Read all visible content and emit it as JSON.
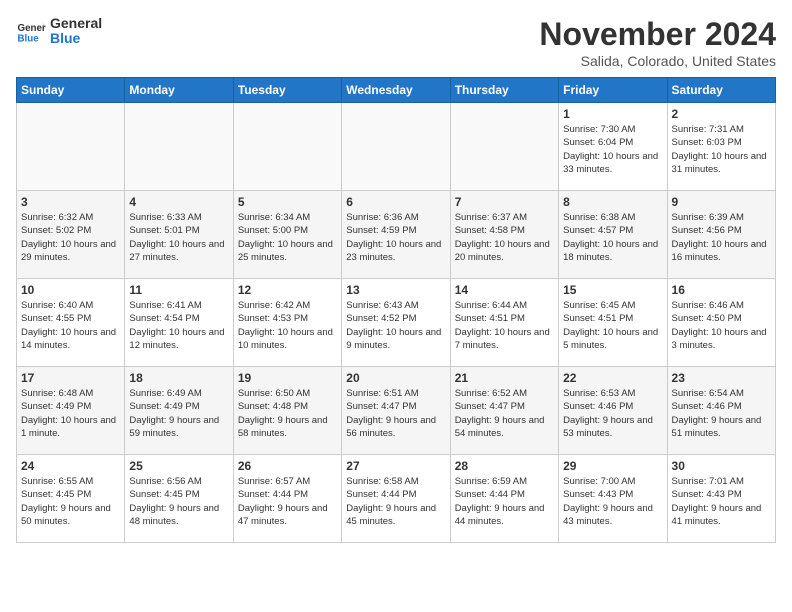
{
  "header": {
    "logo_text_general": "General",
    "logo_text_blue": "Blue",
    "month_year": "November 2024",
    "location": "Salida, Colorado, United States"
  },
  "weekdays": [
    "Sunday",
    "Monday",
    "Tuesday",
    "Wednesday",
    "Thursday",
    "Friday",
    "Saturday"
  ],
  "weeks": [
    [
      {
        "day": "",
        "info": ""
      },
      {
        "day": "",
        "info": ""
      },
      {
        "day": "",
        "info": ""
      },
      {
        "day": "",
        "info": ""
      },
      {
        "day": "",
        "info": ""
      },
      {
        "day": "1",
        "info": "Sunrise: 7:30 AM\nSunset: 6:04 PM\nDaylight: 10 hours and 33 minutes."
      },
      {
        "day": "2",
        "info": "Sunrise: 7:31 AM\nSunset: 6:03 PM\nDaylight: 10 hours and 31 minutes."
      }
    ],
    [
      {
        "day": "3",
        "info": "Sunrise: 6:32 AM\nSunset: 5:02 PM\nDaylight: 10 hours and 29 minutes."
      },
      {
        "day": "4",
        "info": "Sunrise: 6:33 AM\nSunset: 5:01 PM\nDaylight: 10 hours and 27 minutes."
      },
      {
        "day": "5",
        "info": "Sunrise: 6:34 AM\nSunset: 5:00 PM\nDaylight: 10 hours and 25 minutes."
      },
      {
        "day": "6",
        "info": "Sunrise: 6:36 AM\nSunset: 4:59 PM\nDaylight: 10 hours and 23 minutes."
      },
      {
        "day": "7",
        "info": "Sunrise: 6:37 AM\nSunset: 4:58 PM\nDaylight: 10 hours and 20 minutes."
      },
      {
        "day": "8",
        "info": "Sunrise: 6:38 AM\nSunset: 4:57 PM\nDaylight: 10 hours and 18 minutes."
      },
      {
        "day": "9",
        "info": "Sunrise: 6:39 AM\nSunset: 4:56 PM\nDaylight: 10 hours and 16 minutes."
      }
    ],
    [
      {
        "day": "10",
        "info": "Sunrise: 6:40 AM\nSunset: 4:55 PM\nDaylight: 10 hours and 14 minutes."
      },
      {
        "day": "11",
        "info": "Sunrise: 6:41 AM\nSunset: 4:54 PM\nDaylight: 10 hours and 12 minutes."
      },
      {
        "day": "12",
        "info": "Sunrise: 6:42 AM\nSunset: 4:53 PM\nDaylight: 10 hours and 10 minutes."
      },
      {
        "day": "13",
        "info": "Sunrise: 6:43 AM\nSunset: 4:52 PM\nDaylight: 10 hours and 9 minutes."
      },
      {
        "day": "14",
        "info": "Sunrise: 6:44 AM\nSunset: 4:51 PM\nDaylight: 10 hours and 7 minutes."
      },
      {
        "day": "15",
        "info": "Sunrise: 6:45 AM\nSunset: 4:51 PM\nDaylight: 10 hours and 5 minutes."
      },
      {
        "day": "16",
        "info": "Sunrise: 6:46 AM\nSunset: 4:50 PM\nDaylight: 10 hours and 3 minutes."
      }
    ],
    [
      {
        "day": "17",
        "info": "Sunrise: 6:48 AM\nSunset: 4:49 PM\nDaylight: 10 hours and 1 minute."
      },
      {
        "day": "18",
        "info": "Sunrise: 6:49 AM\nSunset: 4:49 PM\nDaylight: 9 hours and 59 minutes."
      },
      {
        "day": "19",
        "info": "Sunrise: 6:50 AM\nSunset: 4:48 PM\nDaylight: 9 hours and 58 minutes."
      },
      {
        "day": "20",
        "info": "Sunrise: 6:51 AM\nSunset: 4:47 PM\nDaylight: 9 hours and 56 minutes."
      },
      {
        "day": "21",
        "info": "Sunrise: 6:52 AM\nSunset: 4:47 PM\nDaylight: 9 hours and 54 minutes."
      },
      {
        "day": "22",
        "info": "Sunrise: 6:53 AM\nSunset: 4:46 PM\nDaylight: 9 hours and 53 minutes."
      },
      {
        "day": "23",
        "info": "Sunrise: 6:54 AM\nSunset: 4:46 PM\nDaylight: 9 hours and 51 minutes."
      }
    ],
    [
      {
        "day": "24",
        "info": "Sunrise: 6:55 AM\nSunset: 4:45 PM\nDaylight: 9 hours and 50 minutes."
      },
      {
        "day": "25",
        "info": "Sunrise: 6:56 AM\nSunset: 4:45 PM\nDaylight: 9 hours and 48 minutes."
      },
      {
        "day": "26",
        "info": "Sunrise: 6:57 AM\nSunset: 4:44 PM\nDaylight: 9 hours and 47 minutes."
      },
      {
        "day": "27",
        "info": "Sunrise: 6:58 AM\nSunset: 4:44 PM\nDaylight: 9 hours and 45 minutes."
      },
      {
        "day": "28",
        "info": "Sunrise: 6:59 AM\nSunset: 4:44 PM\nDaylight: 9 hours and 44 minutes."
      },
      {
        "day": "29",
        "info": "Sunrise: 7:00 AM\nSunset: 4:43 PM\nDaylight: 9 hours and 43 minutes."
      },
      {
        "day": "30",
        "info": "Sunrise: 7:01 AM\nSunset: 4:43 PM\nDaylight: 9 hours and 41 minutes."
      }
    ]
  ]
}
